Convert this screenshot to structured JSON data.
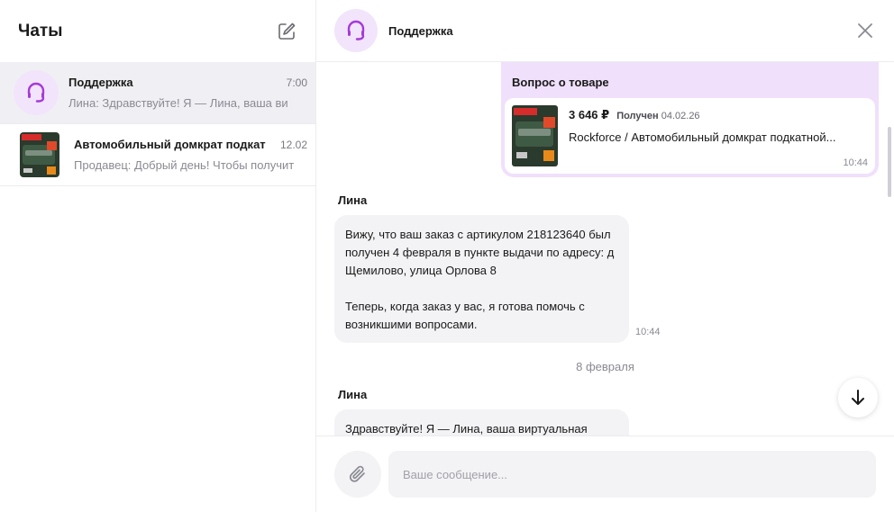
{
  "sidebar": {
    "title": "Чаты",
    "chats": [
      {
        "name": "Поддержка",
        "time": "7:00",
        "preview": "Лина: Здравствуйте! Я — Лина, ваша ви"
      },
      {
        "name": "Автомобильный домкрат подкат",
        "time": "12.02",
        "preview": "Продавец: Добрый день! Чтобы получит"
      }
    ]
  },
  "header": {
    "title": "Поддержка"
  },
  "messages": {
    "product_card": {
      "label": "Вопрос о товаре",
      "price": "3 646 ₽",
      "status": "Получен",
      "date": "04.02.26",
      "title": "Rockforce / Автомобильный домкрат подкатной...",
      "time": "10:44"
    },
    "msg1": {
      "sender": "Лина",
      "para1": "Вижу, что ваш заказ с артикулом 218123640 был получен 4 февраля в пункте выдачи по адресу: д Щемилово, улица Орлова 8",
      "para2": "Теперь, когда заказ у вас, я готова помочь с возникшими вопросами.",
      "time": "10:44"
    },
    "date_separator": "8 февраля",
    "msg2": {
      "sender": "Лина",
      "text": "Здравствуйте! Я — Лина, ваша виртуальная"
    }
  },
  "composer": {
    "placeholder": "Ваше сообщение..."
  },
  "colors": {
    "accent": "#a63ad8",
    "support_bg": "#f1e4fb",
    "card_bg": "#f0e0fb",
    "bubble_bg": "#f3f3f6"
  },
  "icons": [
    "compose-icon",
    "headset-icon",
    "close-icon",
    "arrow-down-icon",
    "paperclip-icon"
  ]
}
